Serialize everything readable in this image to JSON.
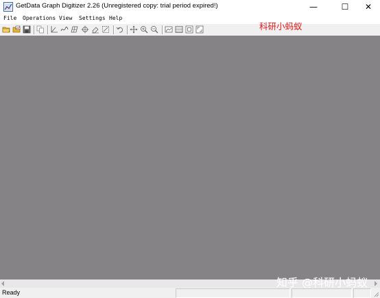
{
  "window": {
    "title": "GetData Graph Digitizer 2.26 (Unregistered copy: trial period expired!)",
    "controls": {
      "minimize": "—",
      "maximize": "☐",
      "close": "✕"
    }
  },
  "menu": {
    "items": [
      "File",
      "Operations",
      "View",
      "Settings",
      "Help"
    ]
  },
  "toolbar": {
    "icons": [
      "open-folder-icon",
      "open-image-icon",
      "save-icon",
      "copy-icon",
      "axis-setup-icon",
      "line-digitize-icon",
      "grid-digitize-icon",
      "point-capture-icon",
      "eraser-icon",
      "select-area-icon",
      "undo-icon",
      "move-icon",
      "zoom-in-icon",
      "zoom-out-icon",
      "image-view-icon",
      "data-table-icon",
      "fit-window-icon",
      "full-size-icon"
    ]
  },
  "watermark": {
    "top": "科研小蚂蚁",
    "bottom": "知乎 @科研小蚂蚁"
  },
  "status": {
    "text": "Ready"
  },
  "colors": {
    "workspace": "#868386",
    "watermark_top": "#e0191b"
  }
}
